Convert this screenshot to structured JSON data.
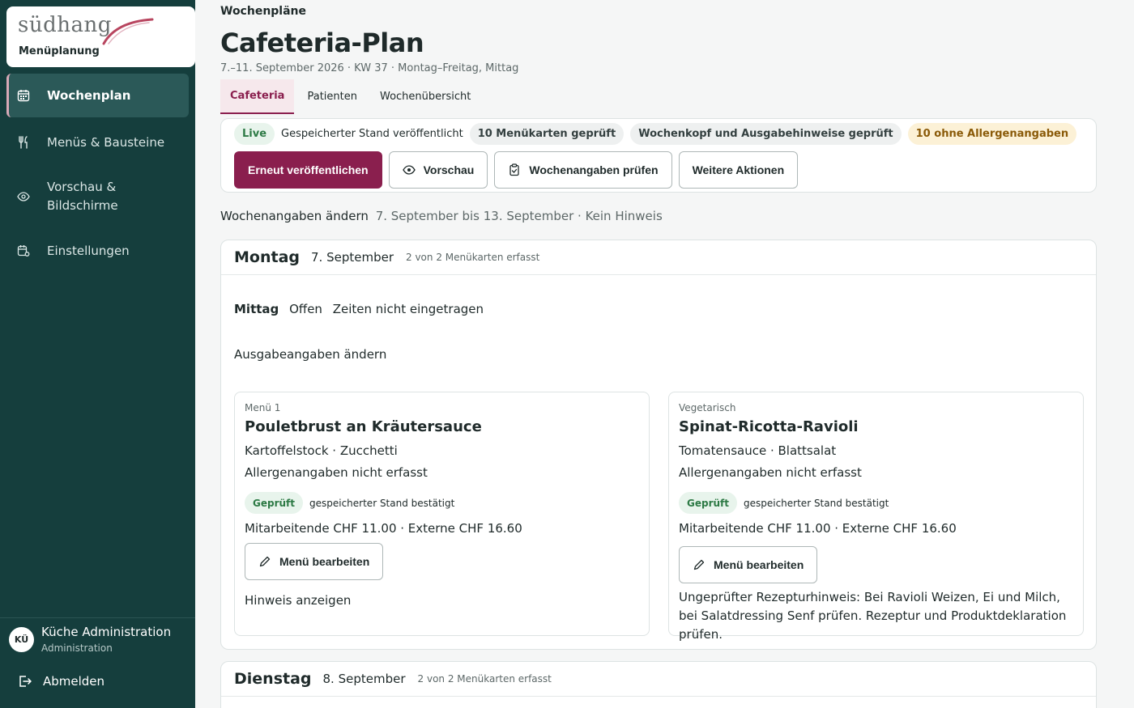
{
  "brand": {
    "name": "südhang",
    "sub": "Menüplanung"
  },
  "nav": {
    "items": [
      {
        "label": "Wochenplan",
        "icon": "calendar-icon"
      },
      {
        "label": "Menüs & Bausteine",
        "icon": "fork-knife-icon"
      },
      {
        "label": "Vorschau & Bildschirme",
        "icon": "eye-icon"
      },
      {
        "label": "Einstellungen",
        "icon": "calendar-settings-icon"
      }
    ]
  },
  "user": {
    "initials": "KÜ",
    "name": "Küche Administration",
    "role": "Administration",
    "logout": "Abmelden"
  },
  "header": {
    "breadcrumb": "Wochenpläne",
    "title": "Cafeteria-Plan",
    "subtitle": "7.–11. September 2026 · KW 37 · Montag–Freitag, Mittag"
  },
  "tabs": [
    "Cafeteria",
    "Patienten",
    "Wochenübersicht"
  ],
  "status": {
    "live": "Live",
    "saved": "Gespeicherter Stand veröffentlicht",
    "checked_cards": "10 Menükarten geprüft",
    "checked_head": "Wochenkopf und Ausgabehinweise geprüft",
    "missing_allergens": "10 ohne Allergenangaben"
  },
  "actions": {
    "publish": "Erneut veröffentlichen",
    "preview": "Vorschau",
    "check": "Wochenangaben prüfen",
    "more": "Weitere Aktionen"
  },
  "week_edit": {
    "label": "Wochenangaben ändern",
    "detail": "7. September bis 13. September · Kein Hinweis"
  },
  "days": [
    {
      "name": "Montag",
      "date": "7. September",
      "count": "2 von 2 Menükarten erfasst",
      "meal": "Mittag",
      "meal_state": "Offen",
      "meal_times": "Zeiten nicht eingetragen",
      "issue_link": "Ausgabeangaben ändern",
      "menus": [
        {
          "kind": "Menü 1",
          "title": "Pouletbrust an Kräutersauce",
          "sides": "Kartoffelstock · Zucchetti",
          "allergens": "Allergenangaben nicht erfasst",
          "check": "Geprüft",
          "check_text": "gespeicherter Stand bestätigt",
          "price": "Mitarbeitende CHF 11.00 · Externe CHF 16.60",
          "edit": "Menü bearbeiten",
          "hint": "Hinweis anzeigen"
        },
        {
          "kind": "Vegetarisch",
          "title": "Spinat-Ricotta-Ravioli",
          "sides": "Tomatensauce · Blattsalat",
          "allergens": "Allergenangaben nicht erfasst",
          "check": "Geprüft",
          "check_text": "gespeicherter Stand bestätigt",
          "price": "Mitarbeitende CHF 11.00 · Externe CHF 16.60",
          "edit": "Menü bearbeiten",
          "hint": "Ungeprüfter Rezepturhinweis: Bei Ravioli Weizen, Ei und Milch, bei Salatdressing Senf prüfen. Rezeptur und Produktdeklaration prüfen."
        }
      ]
    },
    {
      "name": "Dienstag",
      "date": "8. September",
      "count": "2 von 2 Menükarten erfasst"
    }
  ],
  "colors": {
    "sidebar": "#153e3d",
    "accent": "#8a1f4e",
    "ok": "#2d7a45",
    "warn": "#8a5a08"
  }
}
